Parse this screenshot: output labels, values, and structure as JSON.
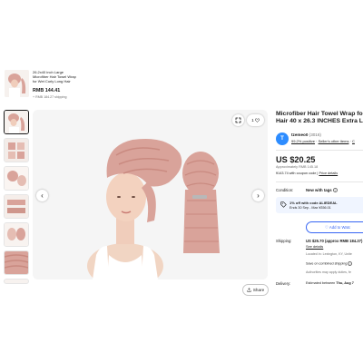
{
  "sticky": {
    "title_line1": "26.2x40 inch Large",
    "title_line2": "Microfiber Hair Towel Wrap",
    "title_line3": "for Wet Curly Long Hair",
    "price": "RMB 144.41",
    "shipping": "+ RMB 184.27 shipping"
  },
  "gallery": {
    "thumb_count": 7,
    "share_label": "Share",
    "watch_count": "1",
    "icons": [
      "expand-icon",
      "heart-icon",
      "chevron-left-icon",
      "chevron-right-icon",
      "share-icon"
    ]
  },
  "product": {
    "title": "Microfiber Hair Towel Wrap fo",
    "title_line2": "Hair 40 x 26.3 INCHES Extra L"
  },
  "seller": {
    "initial": "T",
    "name": "tzemeo0",
    "count": "(3016)",
    "positive": "99.2% positive",
    "other_items": "Seller's other items",
    "contact": "C"
  },
  "pricing": {
    "price": "US $20.25",
    "approx": "Approximately RMB 145.18",
    "coupon_price": "¥143.74 with coupon code",
    "price_details": "Price details"
  },
  "condition": {
    "label": "Condition:",
    "value": "New with tags"
  },
  "coupon": {
    "line1": "1% off with code ALIEDEAL",
    "line2": "Ends 30 Sep - Max ¥356.01"
  },
  "watchlist": {
    "label": "Add to Watc"
  },
  "shipping": {
    "label": "Shipping:",
    "value": "US $25.70 (approx RMB 184.27)",
    "details": "See details",
    "location": "Located in: Lexington, KY, Unite",
    "save": "Save on combined shipping",
    "authorities": "Authorities may apply duties, fe"
  },
  "delivery": {
    "label": "Delivery:",
    "prefix": "Estimated between ",
    "dates": "Thu, Aug 7"
  },
  "colors": {
    "towel_pink": "#d9a39a",
    "link_blue": "#3665f3",
    "avatar_blue": "#2d8cff"
  }
}
